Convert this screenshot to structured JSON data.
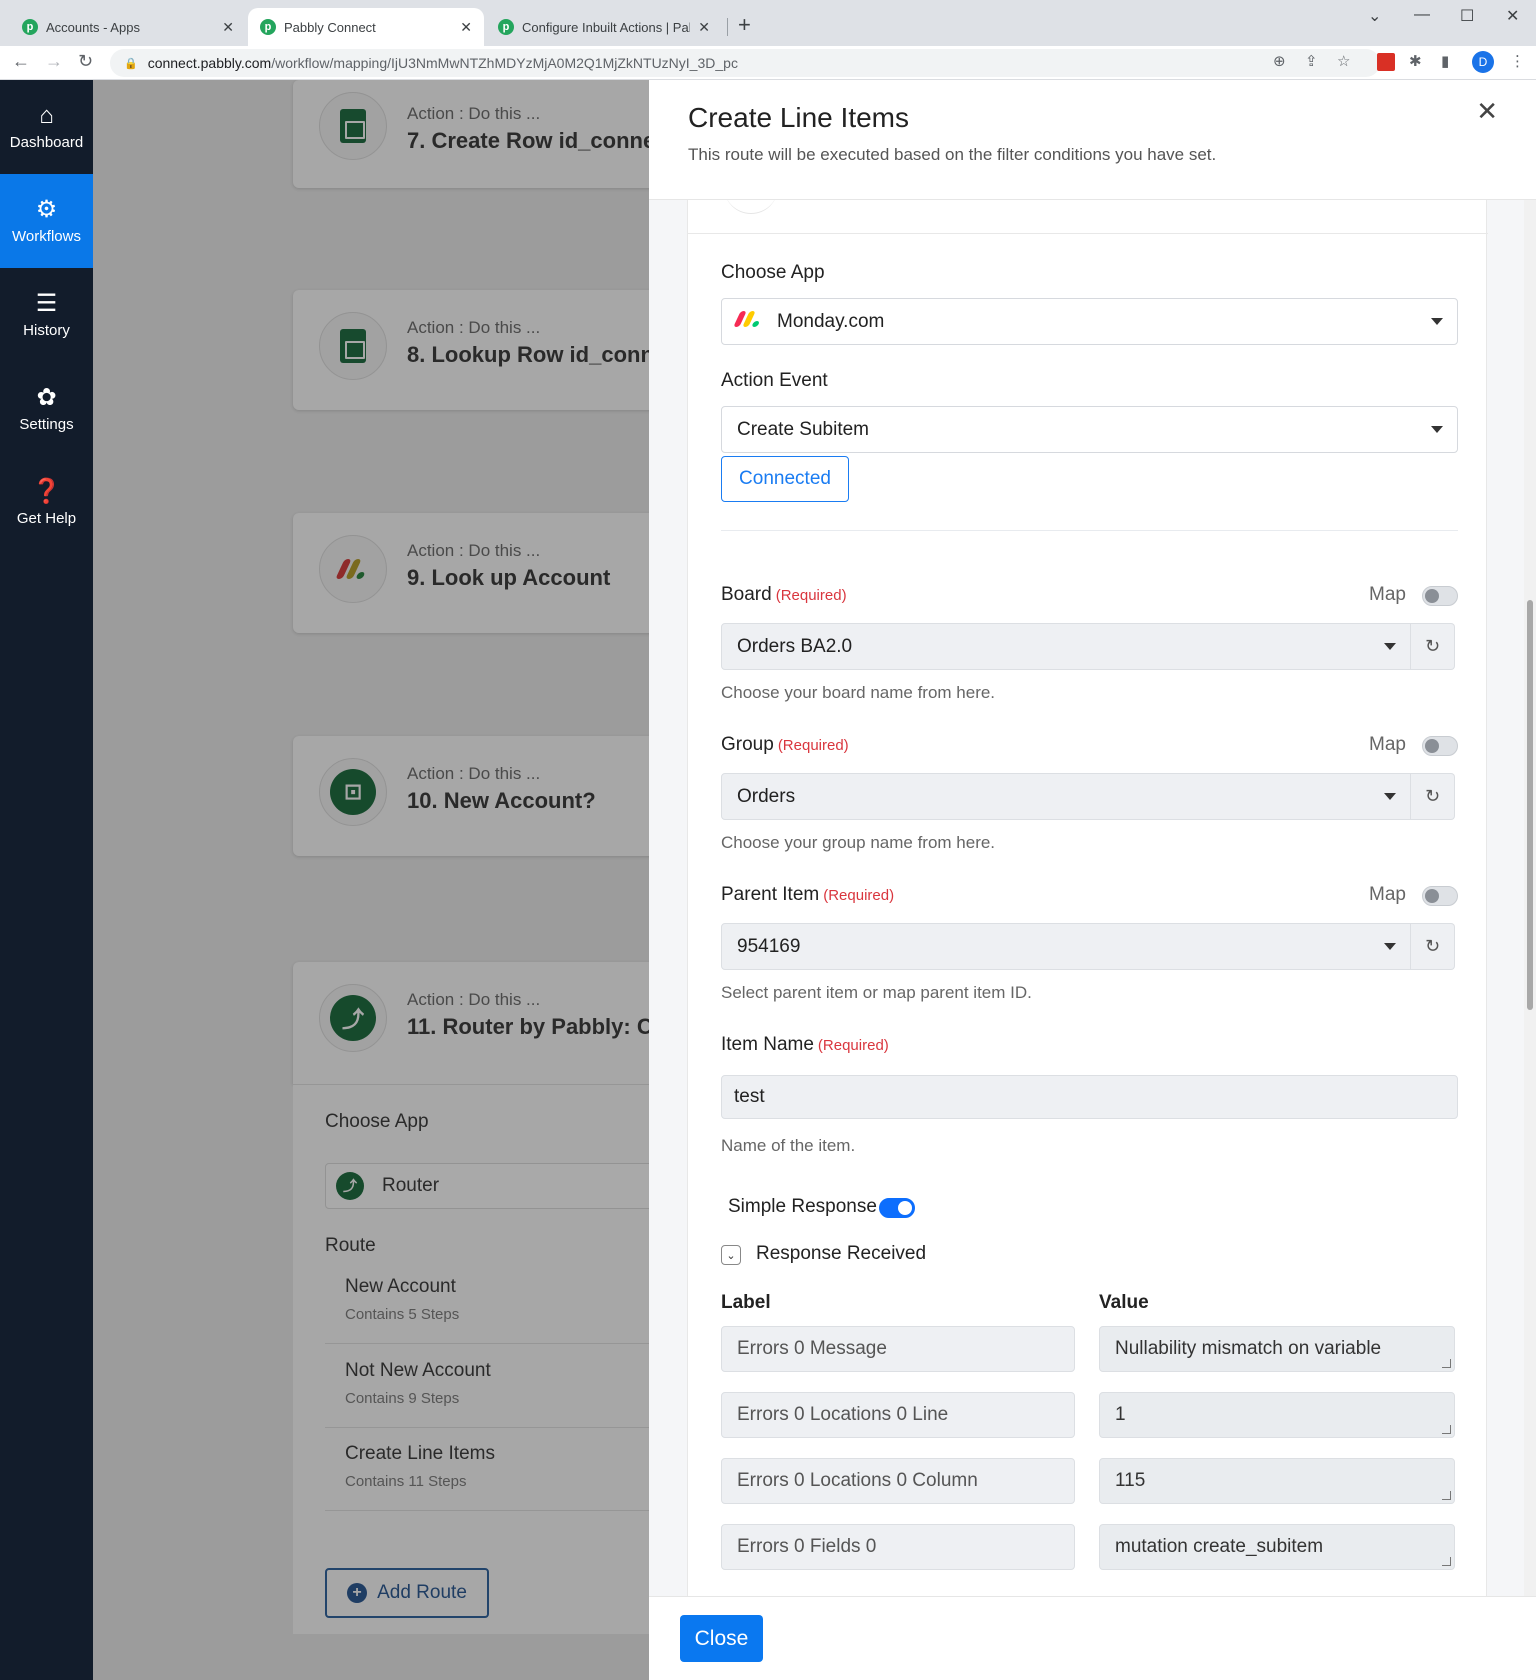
{
  "browser": {
    "tabs": [
      {
        "title": "Accounts - Apps",
        "active": false
      },
      {
        "title": "Pabbly Connect",
        "active": true
      },
      {
        "title": "Configure Inbuilt Actions | Pabbly",
        "active": false
      }
    ],
    "url_host": "connect.pabbly.com",
    "url_path": "/workflow/mapping/IjU3NmMwNTZhMDYzMjA0M2Q1MjZkNTUzNyI_3D_pc",
    "profile_initial": "D"
  },
  "sidebar": {
    "items": [
      {
        "label": "Dashboard",
        "icon": "home-icon"
      },
      {
        "label": "Workflows",
        "icon": "workflow-icon",
        "active": true
      },
      {
        "label": "History",
        "icon": "list-icon"
      },
      {
        "label": "Settings",
        "icon": "gear-icon"
      },
      {
        "label": "Get Help",
        "icon": "help-icon"
      }
    ]
  },
  "canvas": {
    "cards": [
      {
        "label": "Action : Do this ...",
        "name": "7. Create Row id_conne",
        "icon": "google-sheets-icon"
      },
      {
        "label": "Action : Do this ...",
        "name": "8. Lookup Row id_conn",
        "icon": "google-sheets-icon"
      },
      {
        "label": "Action : Do this ...",
        "name": "9. Look up Account",
        "icon": "monday-icon"
      },
      {
        "label": "Action : Do this ...",
        "name": "10. New Account?",
        "icon": "filter-icon"
      },
      {
        "label": "Action : Do this ...",
        "name": "11. Router by Pabbly: C",
        "icon": "router-icon"
      }
    ],
    "router": {
      "choose_app_label": "Choose App",
      "app": "Router",
      "route_label": "Route",
      "routes": [
        {
          "name": "New Account",
          "steps": "Contains 5 Steps"
        },
        {
          "name": "Not New Account",
          "steps": "Contains 9 Steps"
        },
        {
          "name": "Create Line Items",
          "steps": "Contains 11 Steps"
        }
      ],
      "add_route": "Add Route"
    }
  },
  "panel": {
    "title": "Create Line Items",
    "subtitle": "This route will be executed based on the filter conditions you have set.",
    "choose_app_label": "Choose App",
    "app_value": "Monday.com",
    "action_event_label": "Action Event",
    "action_event_value": "Create Subitem",
    "connected_label": "Connected",
    "map_label": "Map",
    "required_label": "(Required)",
    "board": {
      "label": "Board",
      "value": "Orders BA2.0",
      "help": "Choose your board name from here."
    },
    "group": {
      "label": "Group",
      "value": "Orders",
      "help": "Choose your group name from here."
    },
    "parent_item": {
      "label": "Parent Item",
      "value": "954169",
      "help": "Select parent item or map parent item ID."
    },
    "item_name": {
      "label": "Item Name",
      "value": "test",
      "help": "Name of the item."
    },
    "simple_response_label": "Simple Response",
    "response_received_label": "Response Received",
    "columns": {
      "label": "Label",
      "value": "Value"
    },
    "responses": [
      {
        "label": "Errors 0 Message",
        "value": "Nullability mismatch on variable"
      },
      {
        "label": "Errors 0 Locations 0 Line",
        "value": "1"
      },
      {
        "label": "Errors 0 Locations 0 Column",
        "value": "115"
      },
      {
        "label": "Errors 0 Fields 0",
        "value": "mutation create_subitem"
      }
    ],
    "close_button": "Close"
  }
}
